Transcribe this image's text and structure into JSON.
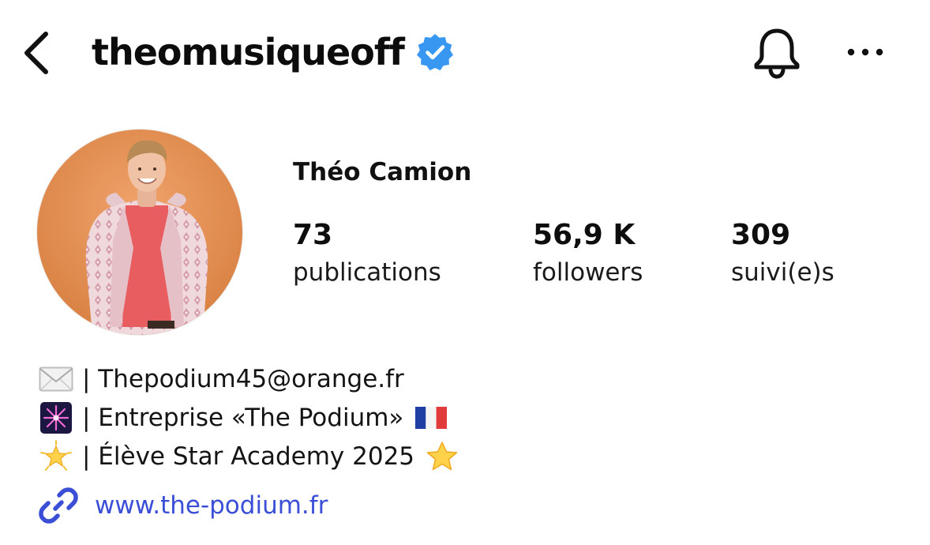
{
  "header": {
    "username": "theomusiqueoff",
    "back_icon": "chevron-left-icon",
    "verified_icon": "verified-badge-icon",
    "bell_icon": "bell-icon",
    "more_icon": "more-horizontal-icon",
    "verified_color": "#3897f0"
  },
  "profile": {
    "display_name": "Théo Camion",
    "stats": [
      {
        "value": "73",
        "label": "publications"
      },
      {
        "value": "56,9 K",
        "label": "followers"
      },
      {
        "value": "309",
        "label": "suivi(e)s"
      }
    ]
  },
  "bio": {
    "lines": [
      {
        "icon": "envelope-icon",
        "text": "| Thepodium45@orange.fr"
      },
      {
        "icon": "fireworks-icon",
        "text": "| Entreprise «The Podium»",
        "trailing_icon": "france-flag-icon"
      },
      {
        "icon": "glowing-star-icon",
        "text": "| Élève Star Academy 2025",
        "trailing_icon": "star-icon"
      }
    ],
    "link": {
      "icon": "link-icon",
      "text": "www.the-podium.fr"
    }
  },
  "colors": {
    "link": "#3a4fd6",
    "text": "#0f0f0f",
    "avatar_bg": "#e0894e"
  }
}
